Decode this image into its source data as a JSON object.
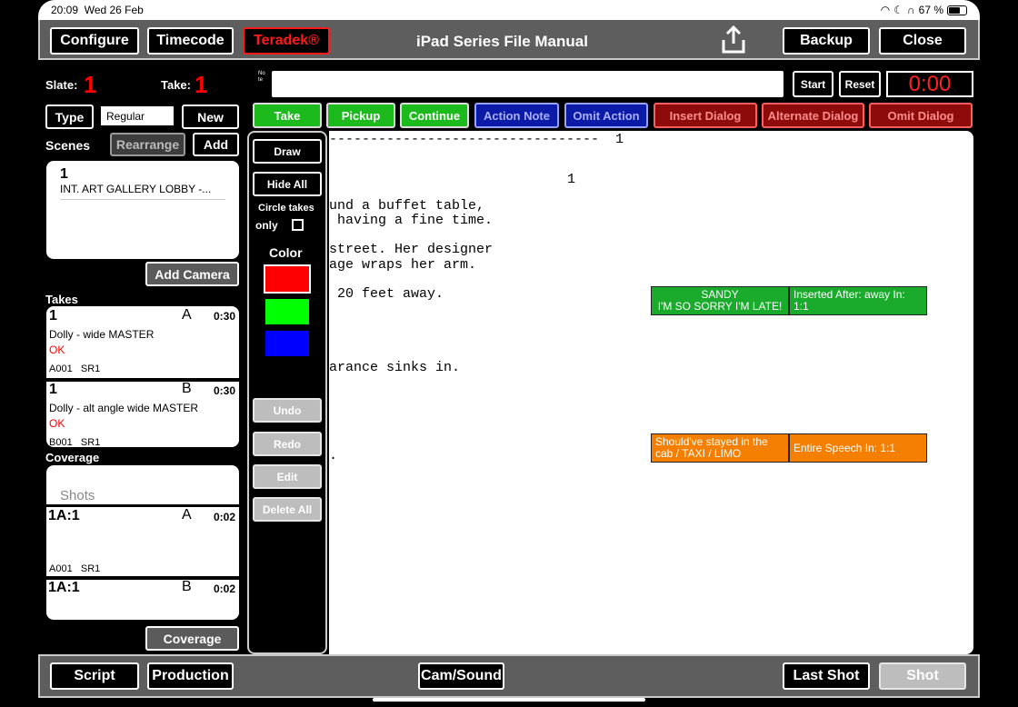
{
  "status": {
    "time": "20:09",
    "date": "Wed 26 Feb",
    "battery_text": "67 %",
    "battery_level": 0.67
  },
  "topbar": {
    "configure": "Configure",
    "timecode": "Timecode",
    "teradek": "Teradek®",
    "title": "iPad Series File Manual",
    "backup": "Backup",
    "close": "Close"
  },
  "slate": {
    "label": "Slate:",
    "value": "1",
    "take_label": "Take:",
    "take_value": "1"
  },
  "note": {
    "side_label": "Note",
    "value": "",
    "start": "Start",
    "reset": "Reset",
    "timer": "0:00"
  },
  "type": {
    "button": "Type",
    "value": "Regular",
    "new": "New"
  },
  "actions": {
    "take": "Take",
    "pickup": "Pickup",
    "continue": "Continue",
    "action_note": "Action Note",
    "omit_action": "Omit Action",
    "insert_dialog": "Insert Dialog",
    "alternate_dialog": "Alternate Dialog",
    "omit_dialog": "Omit Dialog"
  },
  "scenes": {
    "label": "Scenes",
    "rearrange": "Rearrange",
    "add": "Add",
    "items": [
      {
        "number": "1",
        "heading": "INT. ART GALLERY LOBBY -..."
      }
    ],
    "add_camera": "Add Camera"
  },
  "takes": {
    "label": "Takes",
    "items": [
      {
        "num": "1",
        "cam": "A",
        "dur": "0:30",
        "desc": "Dolly - wide MASTER",
        "status": "OK",
        "meta": "A001   SR1"
      },
      {
        "num": "1",
        "cam": "B",
        "dur": "0:30",
        "desc": "Dolly - alt angle wide MASTER",
        "status": "OK",
        "meta": "B001   SR1"
      }
    ]
  },
  "coverage": {
    "label": "Coverage",
    "shots_placeholder": "Shots",
    "items": [
      {
        "num": "1A:1",
        "cam": "A",
        "dur": "0:02",
        "meta": "A001   SR1"
      },
      {
        "num": "1A:1",
        "cam": "B",
        "dur": "0:02",
        "meta": ""
      }
    ],
    "button": "Coverage"
  },
  "drawing": {
    "draw": "Draw",
    "hide_all": "Hide All",
    "circle_takes": "Circle takes",
    "only": "only",
    "color_label": "Color",
    "colors": [
      "#ff0000",
      "#00ff00",
      "#0000ff"
    ],
    "undo": "Undo",
    "redo": "Redo",
    "edit": "Edit",
    "delete_all": "Delete All"
  },
  "script": {
    "lines": [
      "---------------------------------  1",
      "1",
      "und a buffet table,",
      " having a fine time.",
      "street. Her designer",
      "age wraps her arm.",
      " 20 feet away.",
      "arance sinks in.",
      "."
    ],
    "notes": [
      {
        "left": "SANDY\nI'M SO SORRY I'M LATE!",
        "right": "Inserted After: away In: 1:1",
        "color": "#1aab2d"
      },
      {
        "left": "Should've stayed in the cab / TAXI / LIMO",
        "right": "Entire Speech In: 1:1",
        "color": "#f57f00"
      }
    ]
  },
  "bottombar": {
    "script": "Script",
    "production": "Production",
    "cam_sound": "Cam/Sound",
    "last_shot": "Last Shot",
    "shot": "Shot"
  }
}
